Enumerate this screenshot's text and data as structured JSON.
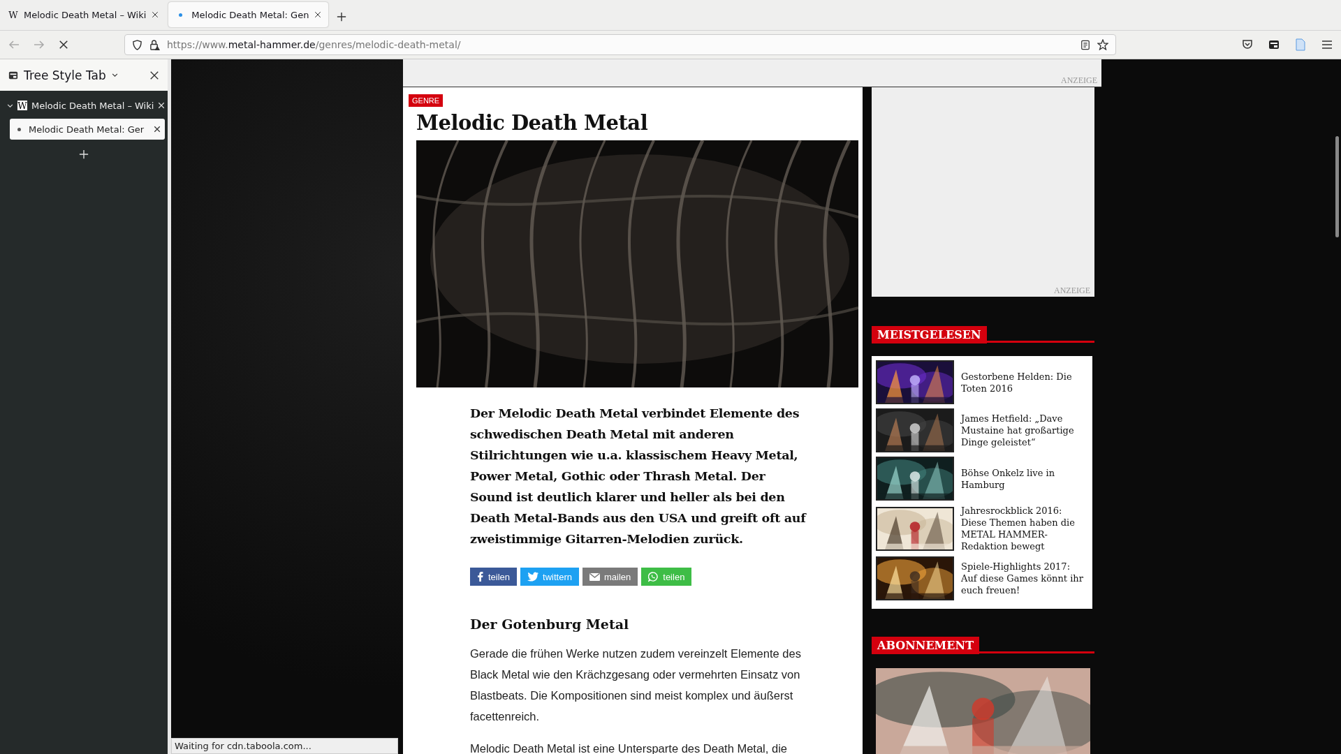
{
  "browser": {
    "tabs": [
      {
        "title": "Melodic Death Metal – Wiki",
        "favicon": "W",
        "selected": false
      },
      {
        "title": "Melodic Death Metal: Gen",
        "loading": true,
        "selected": true
      }
    ],
    "url": {
      "scheme": "https://www.",
      "domain": "metal-hammer.de",
      "path": "/genres/melodic-death-metal/"
    }
  },
  "sidebar": {
    "title": "Tree Style Tab",
    "tree": [
      {
        "title": "Melodic Death Metal – Wiki",
        "favicon": "W",
        "expanded": true,
        "selected": false,
        "children": [
          {
            "title": "Melodic Death Metal: Ger",
            "selected": true
          }
        ]
      }
    ]
  },
  "page": {
    "top_ad": {
      "label": "ANZEIGE"
    },
    "article": {
      "badge": "GENRE",
      "title": "Melodic Death Metal",
      "lead": "Der Melodic Death Metal verbindet Elemente des schwedischen Death Metal mit anderen Stilrichtungen wie u.a. klassischem Heavy Metal, Power Metal, Gothic oder Thrash Metal. Der Sound ist deutlich klarer und heller als bei den Death Metal-Bands aus den USA und greift oft auf zweistimmige Gitarren-Melodien zurück.",
      "share": [
        {
          "kind": "facebook",
          "label": "teilen",
          "color": "#3b5998"
        },
        {
          "kind": "twitter",
          "label": "twittern",
          "color": "#1da1f2"
        },
        {
          "kind": "mail",
          "label": "mailen",
          "color": "#7a7a7a"
        },
        {
          "kind": "whatsapp",
          "label": "teilen",
          "color": "#3ebd46"
        }
      ],
      "heading": "Der Gotenburg Metal",
      "paragraphs": [
        "Gerade die frühen Werke nutzen zudem vereinzelt Elemente des Black Metal wie den Krächzgesang oder vermehrten Einsatz von Blastbeats. Die Kompositionen sind meist komplex und äußerst facettenreich.",
        "Melodic Death Metal ist eine Untersparte des Death Metal, die"
      ]
    },
    "aside": {
      "ad": {
        "label": "ANZEIGE"
      },
      "most_read": {
        "title": "MEISTGELESEN",
        "items": [
          {
            "title": "Gestorbene Helden: Die Toten 2016"
          },
          {
            "title": "James Hetfield: „Dave Mustaine hat großartige Dinge geleistet“"
          },
          {
            "title": "Böhse Onkelz live in Hamburg"
          },
          {
            "title": "Jahresrockblick 2016: Diese Themen haben die METAL HAMMER-Redaktion bewegt"
          },
          {
            "title": "Spiele-Highlights 2017: Auf diese Games könnt ihr euch freuen!"
          }
        ]
      },
      "subscription": {
        "title": "ABONNEMENT"
      }
    }
  },
  "status_bar": {
    "text": "Waiting for cdn.taboola.com..."
  }
}
